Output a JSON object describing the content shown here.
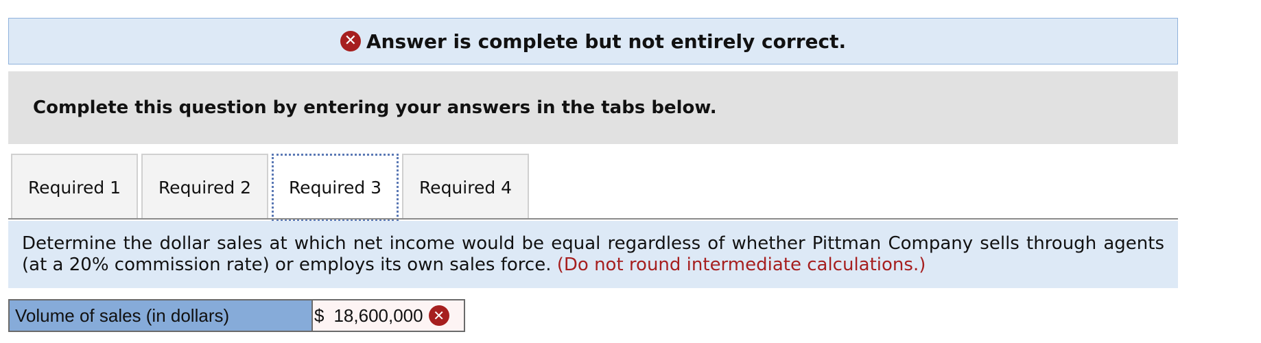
{
  "banner": {
    "status_icon": "x-circle-icon",
    "status_color": "#a61f1f",
    "text": "Answer is complete but not entirely correct."
  },
  "instruction": {
    "text": "Complete this question by entering your answers in the tabs below."
  },
  "tabs": [
    {
      "label": "Required 1",
      "active": false
    },
    {
      "label": "Required 2",
      "active": false
    },
    {
      "label": "Required 3",
      "active": true
    },
    {
      "label": "Required 4",
      "active": false
    }
  ],
  "question": {
    "text": "Determine the dollar sales at which net income would be equal regardless of whether Pittman Company sells through agents (at a 20% commission rate) or employs its own sales force.",
    "note": "(Do not round intermediate calculations.)"
  },
  "answer": {
    "label": "Volume of sales (in dollars)",
    "currency": "$",
    "value": "18,600,000",
    "status_icon": "x-circle-icon"
  },
  "colors": {
    "banner_bg": "#dde9f6",
    "instruction_bg": "#e1e1e1",
    "label_bg": "#86abd9",
    "error_red": "#a61f1f"
  }
}
